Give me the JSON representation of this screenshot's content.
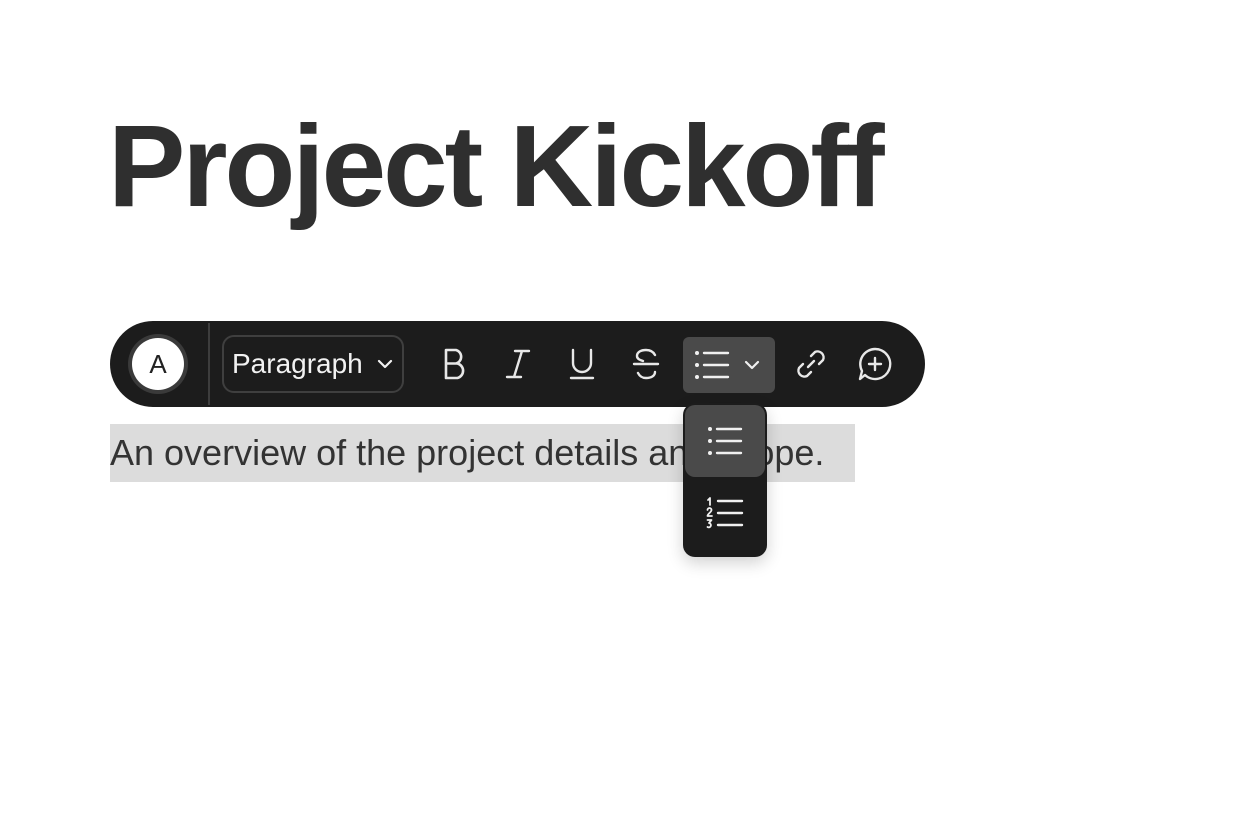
{
  "document": {
    "title": "Project Kickoff",
    "body_text": "An overview of the project details and scope."
  },
  "toolbar": {
    "avatar_letter": "A",
    "format_select": {
      "value": "Paragraph"
    },
    "buttons": [
      {
        "name": "bold",
        "icon": "bold-icon"
      },
      {
        "name": "italic",
        "icon": "italic-icon"
      },
      {
        "name": "underline",
        "icon": "underline-icon"
      },
      {
        "name": "strikethrough",
        "icon": "strikethrough-icon"
      },
      {
        "name": "list",
        "icon": "bulleted-list-icon",
        "active": true
      },
      {
        "name": "link",
        "icon": "link-icon"
      },
      {
        "name": "comment",
        "icon": "add-comment-icon"
      }
    ]
  },
  "list_dropdown": {
    "options": [
      {
        "name": "bulleted-list",
        "icon": "bulleted-list-icon",
        "selected": true
      },
      {
        "name": "numbered-list",
        "icon": "numbered-list-icon",
        "selected": false
      }
    ]
  },
  "colors": {
    "toolbar_bg": "#1c1c1c",
    "active_bg": "#4a4a4a",
    "selection_bg": "#dcdcdc",
    "text": "#2f2f2f"
  }
}
